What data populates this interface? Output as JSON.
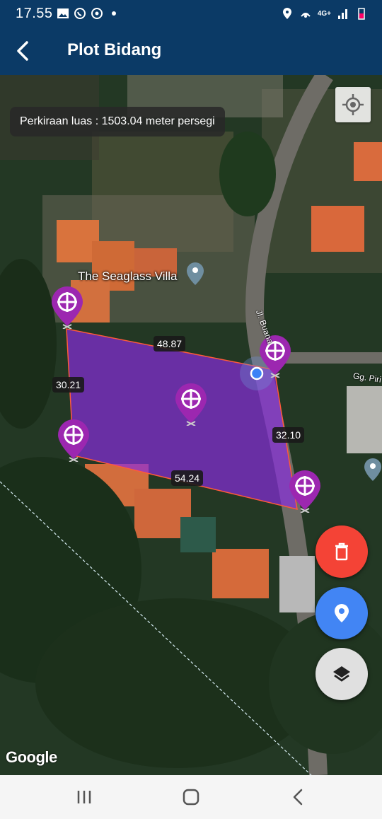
{
  "status_bar": {
    "time": "17.55",
    "network": "4G+"
  },
  "app_bar": {
    "title": "Plot Bidang",
    "back_icon": "arrow-back-icon"
  },
  "map": {
    "area_estimate": "Perkiraan luas : 1503.04 meter persegi",
    "place_label": "The Seaglass Villa",
    "road_label_1": "Jl. Buana",
    "road_label_2": "Gg. Piri",
    "attribution": "Google",
    "polygon_color": "#8a2be2",
    "edge_lengths": {
      "top": "48.87",
      "left": "30.21",
      "right": "32.10",
      "bottom": "54.24"
    }
  },
  "fabs": {
    "delete": {
      "icon": "trash-icon",
      "color": "#f44336"
    },
    "add_point": {
      "icon": "location-pin-icon",
      "color": "#4285f4"
    },
    "layers": {
      "icon": "layers-icon",
      "color": "#e0e0e0"
    }
  },
  "nav_bar": {
    "recent": "recents-icon",
    "home": "home-icon",
    "back": "back-icon"
  }
}
